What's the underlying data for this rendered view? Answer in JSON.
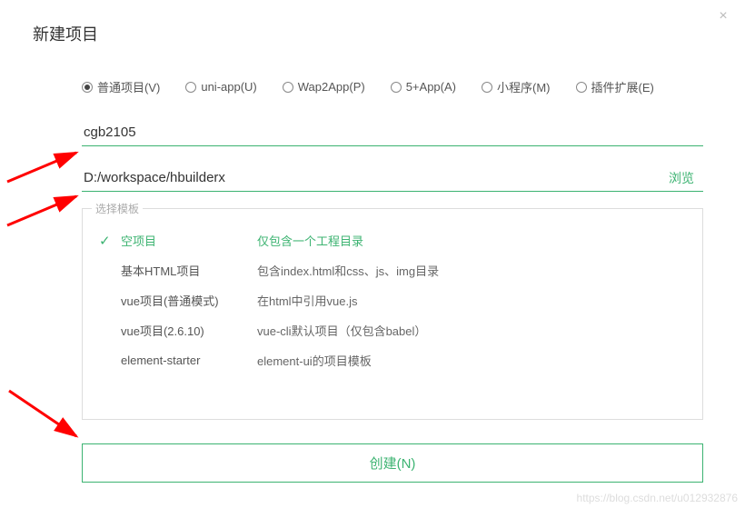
{
  "dialog": {
    "title": "新建项目",
    "close_icon": "×"
  },
  "project_types": [
    {
      "label": "普通项目(V)",
      "checked": true
    },
    {
      "label": "uni-app(U)",
      "checked": false
    },
    {
      "label": "Wap2App(P)",
      "checked": false
    },
    {
      "label": "5+App(A)",
      "checked": false
    },
    {
      "label": "小程序(M)",
      "checked": false
    },
    {
      "label": "插件扩展(E)",
      "checked": false
    }
  ],
  "name_input": {
    "value": "cgb2105"
  },
  "path_input": {
    "value": "D:/workspace/hbuilderx",
    "browse_label": "浏览"
  },
  "template_box": {
    "legend": "选择模板",
    "items": [
      {
        "name": "空项目",
        "desc": "仅包含一个工程目录",
        "selected": true
      },
      {
        "name": "基本HTML项目",
        "desc": "包含index.html和css、js、img目录",
        "selected": false
      },
      {
        "name": "vue项目(普通模式)",
        "desc": "在html中引用vue.js",
        "selected": false
      },
      {
        "name": "vue项目(2.6.10)",
        "desc": "vue-cli默认项目（仅包含babel）",
        "selected": false
      },
      {
        "name": "element-starter",
        "desc": "element-ui的项目模板",
        "selected": false
      }
    ]
  },
  "create_button": {
    "label": "创建(N)"
  },
  "watermark": "https://blog.csdn.net/u012932876"
}
